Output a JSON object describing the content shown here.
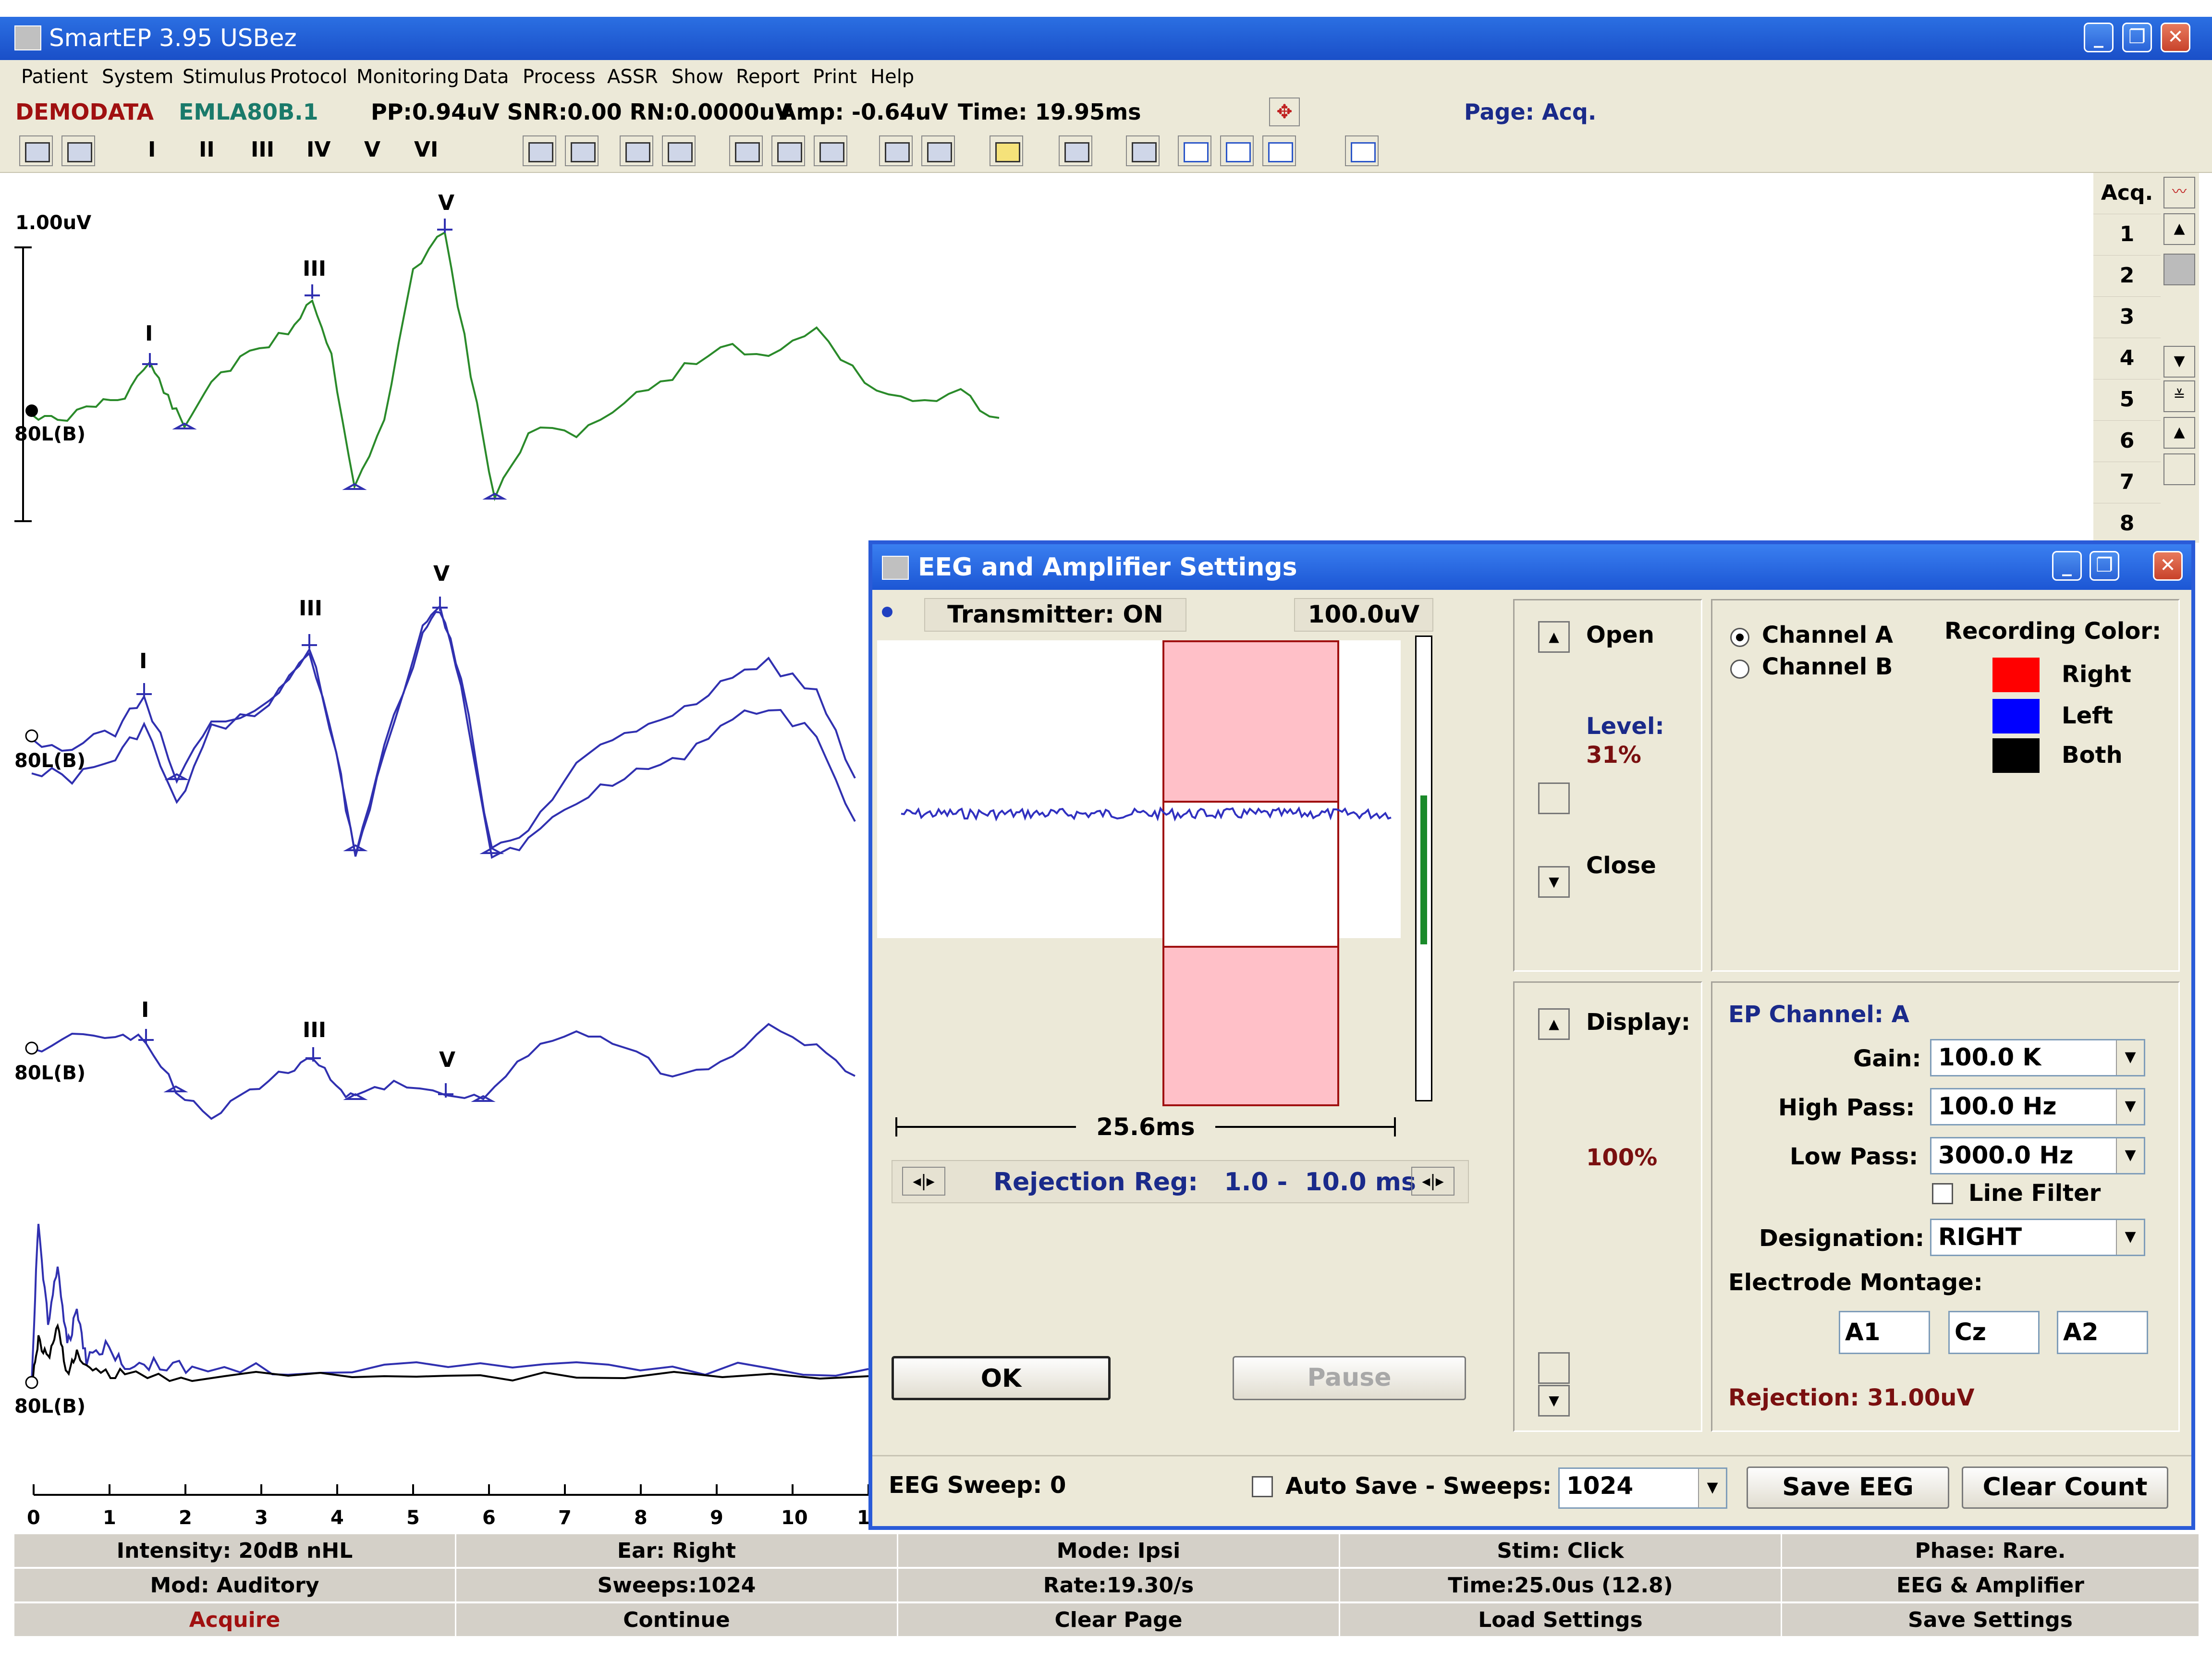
{
  "window": {
    "title": "SmartEP 3.95 USBez",
    "minimize": "_",
    "restore": "❐",
    "close": "✕"
  },
  "menu": [
    "Patient",
    "System",
    "Stimulus",
    "Protocol",
    "Monitoring",
    "Data",
    "Process",
    "ASSR",
    "Show",
    "Report",
    "Print",
    "Help"
  ],
  "info": {
    "patient": "DEMODATA",
    "file": "EMLA80B.1",
    "pp": "PP:0.94uV SNR:0.00 RN:0.0000uV",
    "amp": "Amp: -0.64uV",
    "time": "Time: 19.95ms",
    "page": "Page: Acq."
  },
  "toolbar": {
    "roman": [
      "I",
      "II",
      "III",
      "IV",
      "V",
      "VI"
    ]
  },
  "waveforms": {
    "scale_label": "1.00uV",
    "channel_labels": [
      "80L(B)",
      "80L(B)",
      "80L(B)",
      "80L(B)"
    ],
    "peak_labels": {
      "p1_I": "I",
      "p1_III": "III",
      "p1_V": "V",
      "p2_I": "I",
      "p2_III": "III",
      "p2_V": "V",
      "p3_I": "I",
      "p3_III": "III",
      "p3_V": "V"
    },
    "colors": {
      "green": "#2a8a2a",
      "blue": "#3030b0",
      "black": "#000000"
    },
    "time_axis": [
      "0",
      "1",
      "2",
      "3",
      "4",
      "5",
      "6",
      "7",
      "8",
      "9",
      "10",
      "1"
    ]
  },
  "channels": {
    "header": "Acq.",
    "items": [
      "1",
      "2",
      "3",
      "4",
      "5",
      "6",
      "7",
      "8"
    ]
  },
  "status": {
    "row1": [
      "Intensity: 20dB nHL",
      "Ear: Right",
      "Mode: Ipsi",
      "Stim: Click",
      "Phase: Rare."
    ],
    "row2": [
      "Mod: Auditory",
      "Sweeps:1024",
      "Rate:19.30/s",
      "Time:25.0us (12.8)",
      "EEG & Amplifier"
    ],
    "row3": [
      "Acquire",
      "Continue",
      "Clear Page",
      "Load Settings",
      "Save Settings"
    ]
  },
  "dialog": {
    "title": "EEG and Amplifier Settings",
    "transmitter": "Transmitter: ON",
    "scale": "100.0uV",
    "duration": "25.6ms",
    "rejection_region": "Rejection Reg:   1.0 -  10.0 ms",
    "ok": "OK",
    "pause": "Pause",
    "open": "Open",
    "level_label": "Level:",
    "level_value": "31%",
    "close_label": "Close",
    "display_label": "Display:",
    "display_value": "100%",
    "channel_a": "Channel A",
    "channel_b": "Channel B",
    "recording_color": "Recording Color:",
    "color_right": "Right",
    "color_left": "Left",
    "color_both": "Both",
    "swatches": {
      "right": "#ff0000",
      "left": "#0000ff",
      "both": "#000000"
    },
    "ep_channel": "EP Channel: A",
    "gain_label": "Gain:",
    "gain_value": "100.0 K",
    "high_pass_label": "High Pass:",
    "high_pass_value": "100.0 Hz",
    "low_pass_label": "Low Pass:",
    "low_pass_value": "3000.0 Hz",
    "line_filter": "Line Filter",
    "designation_label": "Designation:",
    "designation_value": "RIGHT",
    "electrode_montage": "Electrode Montage:",
    "electrodes": [
      "A1",
      "Cz",
      "A2"
    ],
    "rejection": "Rejection: 31.00uV",
    "eeg_sweep": "EEG Sweep: 0",
    "auto_save": "Auto Save - Sweeps:",
    "sweeps_value": "1024",
    "save_eeg": "Save EEG",
    "clear_count": "Clear Count"
  }
}
